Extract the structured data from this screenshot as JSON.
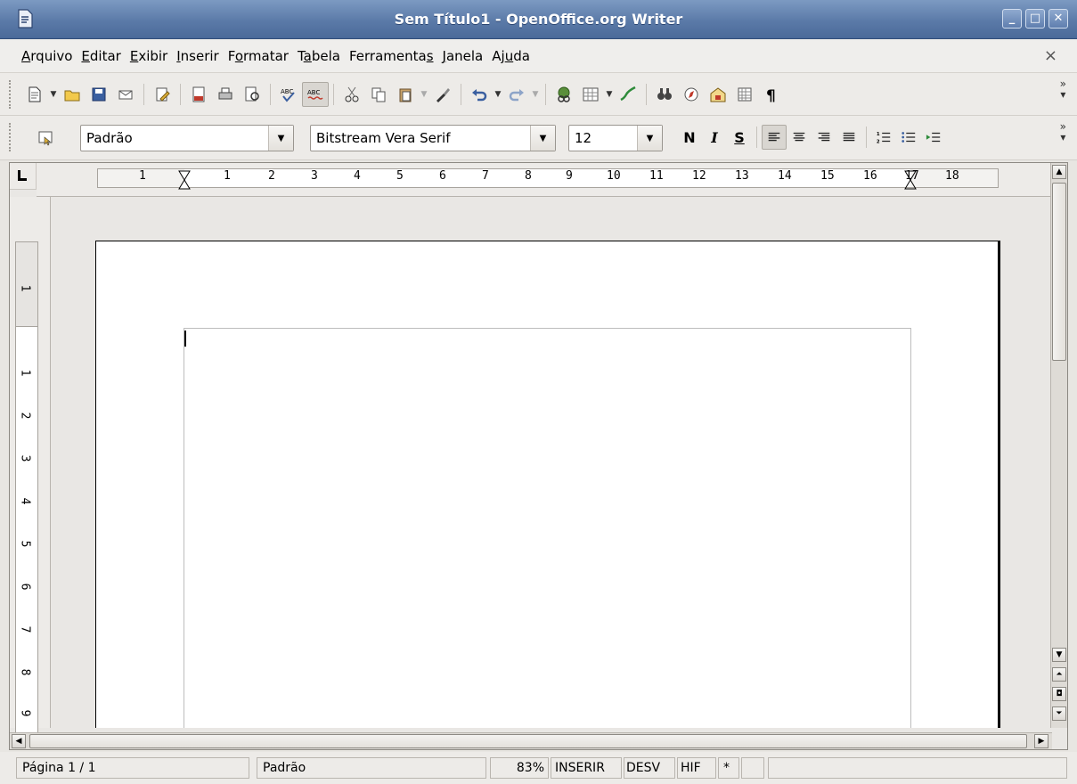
{
  "window": {
    "title": "Sem Título1 - OpenOffice.org Writer"
  },
  "menu": {
    "items": [
      {
        "label": "Arquivo"
      },
      {
        "label": "Editar"
      },
      {
        "label": "Exibir"
      },
      {
        "label": "Inserir"
      },
      {
        "label": "Formatar"
      },
      {
        "label": "Tabela"
      },
      {
        "label": "Ferramentas"
      },
      {
        "label": "Janela"
      },
      {
        "label": "Ajuda"
      }
    ],
    "close_glyph": "×"
  },
  "toolbar": {
    "overflow_glyph": "»",
    "icons": [
      "new-document-icon",
      "open-folder-icon",
      "save-icon",
      "email-icon",
      "edit-file-icon",
      "export-pdf-icon",
      "print-icon",
      "page-preview-icon",
      "spellcheck-icon",
      "autospellcheck-icon",
      "cut-icon",
      "copy-icon",
      "paste-icon",
      "format-paintbrush-icon",
      "undo-icon",
      "redo-icon",
      "hyperlink-icon",
      "table-icon",
      "draw-functions-icon",
      "find-replace-icon",
      "navigator-icon",
      "gallery-icon",
      "data-sources-icon",
      "formatting-marks-icon"
    ]
  },
  "formatting": {
    "style_value": "Padrão",
    "font_value": "Bitstream Vera Serif",
    "size_value": "12",
    "bold_label": "N",
    "italic_label": "I",
    "underline_label": "S"
  },
  "ruler": {
    "h_numbers": [
      "1",
      "1",
      "2",
      "3",
      "4",
      "5",
      "6",
      "7",
      "8",
      "9",
      "10",
      "11",
      "12",
      "13",
      "14",
      "15",
      "16",
      "17",
      "18"
    ],
    "v_numbers": [
      "1",
      "1",
      "2",
      "3",
      "4",
      "5",
      "6",
      "7",
      "8",
      "9"
    ]
  },
  "status": {
    "page": "Página 1 / 1",
    "style": "Padrão",
    "zoom": "83%",
    "insert_mode": "INSERIR",
    "selection_mode": "DESV",
    "hyperlink_mode": "HIF",
    "modified": "*"
  },
  "colors": {
    "titlebar": "#5b7aa8",
    "chrome": "#edebe8",
    "page": "#ffffff"
  }
}
